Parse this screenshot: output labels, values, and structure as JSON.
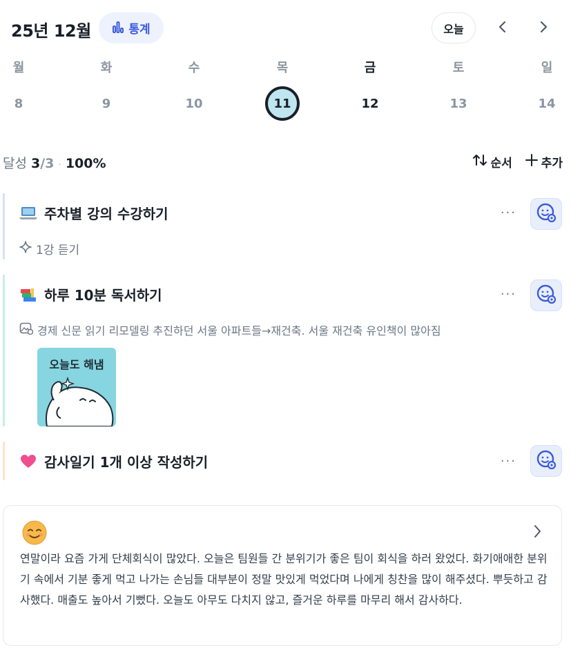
{
  "header": {
    "month_title": "25년 12월",
    "stats_label": "통계",
    "today_label": "오늘"
  },
  "week": {
    "days": [
      {
        "weekday": "월",
        "date": "8",
        "state": "normal"
      },
      {
        "weekday": "화",
        "date": "9",
        "state": "normal"
      },
      {
        "weekday": "수",
        "date": "10",
        "state": "normal"
      },
      {
        "weekday": "목",
        "date": "11",
        "state": "selected"
      },
      {
        "weekday": "금",
        "date": "12",
        "state": "active"
      },
      {
        "weekday": "토",
        "date": "13",
        "state": "normal"
      },
      {
        "weekday": "일",
        "date": "14",
        "state": "normal"
      }
    ]
  },
  "progress": {
    "label": "달성",
    "count": "3",
    "total": "/3",
    "separator": "·",
    "percent": "100%"
  },
  "actions": {
    "order_label": "순서",
    "add_label": "추가"
  },
  "tasks": [
    {
      "title": "주차별 강의 수강하기",
      "emoji": "laptop-icon",
      "bar_color": "#d6e0fb",
      "sub_text": "1강 듣기",
      "more": "···"
    },
    {
      "title": "하루 10분 독서하기",
      "emoji": "books-icon",
      "bar_color": "#c3efe3",
      "sub_text": "경제 신문 읽기 리모델링 추진하던 서울 아파트들→재건축. 서울 재건축 유인책이 많아짐",
      "sticker_text": "오늘도 해냄",
      "more": "···"
    },
    {
      "title": "감사일기 1개 이상 작성하기",
      "emoji": "heart-icon",
      "bar_color": "#fde2c8",
      "more": "···"
    }
  ],
  "diary": {
    "text": "연말이라 요즘 가게 단체회식이 많았다. 오늘은 팀원들 간 분위기가 좋은 팀이 회식을 하러 왔었다. 화기애애한 분위기 속에서 기분 좋게 먹고 나가는 손님들 대부분이 정말 맛있게 먹었다며 나에게 칭찬을 많이 해주셨다. 뿌듯하고 감사했다. 매출도 높아서 기뻤다. 오늘도 아무도 다치지 않고, 즐거운 하루를 마무리 해서 감사하다."
  },
  "colors": {
    "accent": "#3b5bdb",
    "selected_fill": "#bfe6f0",
    "sticker_bg": "#86d5e0"
  }
}
